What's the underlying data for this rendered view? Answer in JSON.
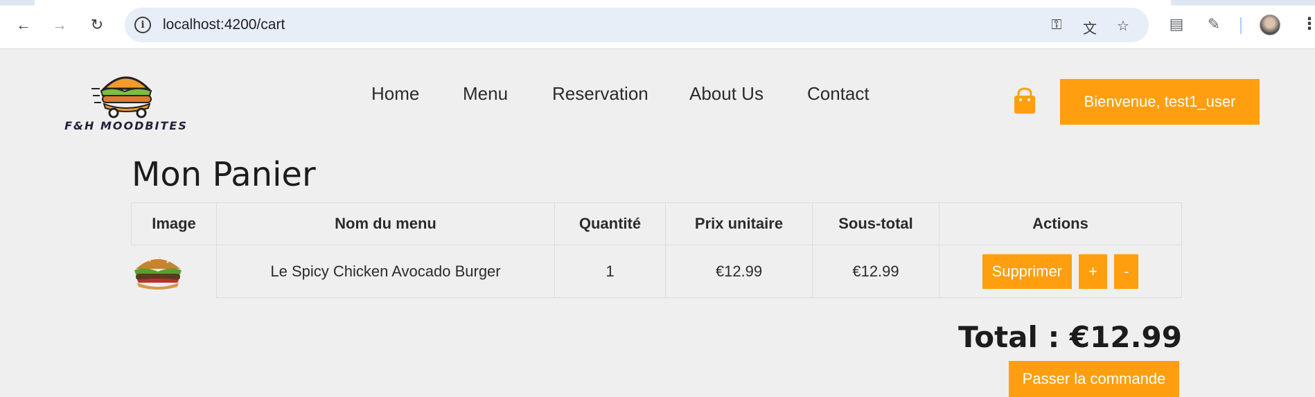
{
  "browser": {
    "url": "localhost:4200/cart"
  },
  "site": {
    "logo_text": "F&H MOODBITES",
    "nav": [
      "Home",
      "Menu",
      "Reservation",
      "About Us",
      "Contact"
    ],
    "welcome_label": "Bienvenue, test1_user",
    "accent_color": "#ff9f0f"
  },
  "cart": {
    "title": "Mon Panier",
    "headers": [
      "Image",
      "Nom du menu",
      "Quantité",
      "Prix unitaire",
      "Sous-total",
      "Actions"
    ],
    "rows": [
      {
        "name": "Le Spicy Chicken Avocado Burger",
        "quantity": "1",
        "unit_price": "€12.99",
        "subtotal": "€12.99",
        "actions": {
          "remove": "Supprimer",
          "increment": "+",
          "decrement": "-"
        }
      }
    ],
    "total": "Total : €12.99",
    "checkout_label": "Passer la commande"
  }
}
